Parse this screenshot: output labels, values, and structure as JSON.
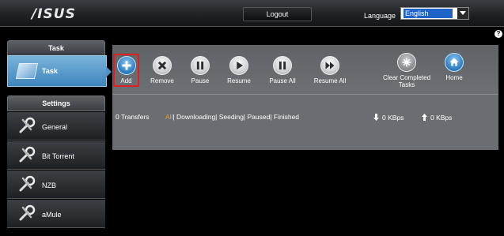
{
  "header": {
    "logo": "/ISUS",
    "logout_label": "Logout",
    "language_label": "Language",
    "language_value": "English"
  },
  "sidebar": {
    "task_heading": "Task",
    "task_item": "Task",
    "settings_heading": "Settings",
    "items": [
      {
        "label": "General"
      },
      {
        "label": "Bit Torrent"
      },
      {
        "label": "NZB"
      },
      {
        "label": "aMule"
      }
    ]
  },
  "toolbar": {
    "buttons": [
      {
        "label": "Add",
        "icon": "plus-icon",
        "highlighted": true
      },
      {
        "label": "Remove",
        "icon": "x-icon"
      },
      {
        "label": "Pause",
        "icon": "pause-icon"
      },
      {
        "label": "Resume",
        "icon": "play-icon"
      },
      {
        "label": "Pause All",
        "icon": "pause-all-icon"
      },
      {
        "label": "Resume All",
        "icon": "fast-forward-icon"
      },
      {
        "label": "Clear Completed Tasks",
        "icon": "clear-icon"
      },
      {
        "label": "Home",
        "icon": "home-icon"
      }
    ]
  },
  "status": {
    "transfers": "0 Transfers",
    "filter_all": "All",
    "filter_rest": "| Downloading| Seeding| Paused| Finished",
    "download_rate": "0 KBps",
    "upload_rate": "0 KBps"
  },
  "colors": {
    "accent_blue": "#3f86bd",
    "highlight_red": "#e02020",
    "filter_active": "#f0a020"
  }
}
